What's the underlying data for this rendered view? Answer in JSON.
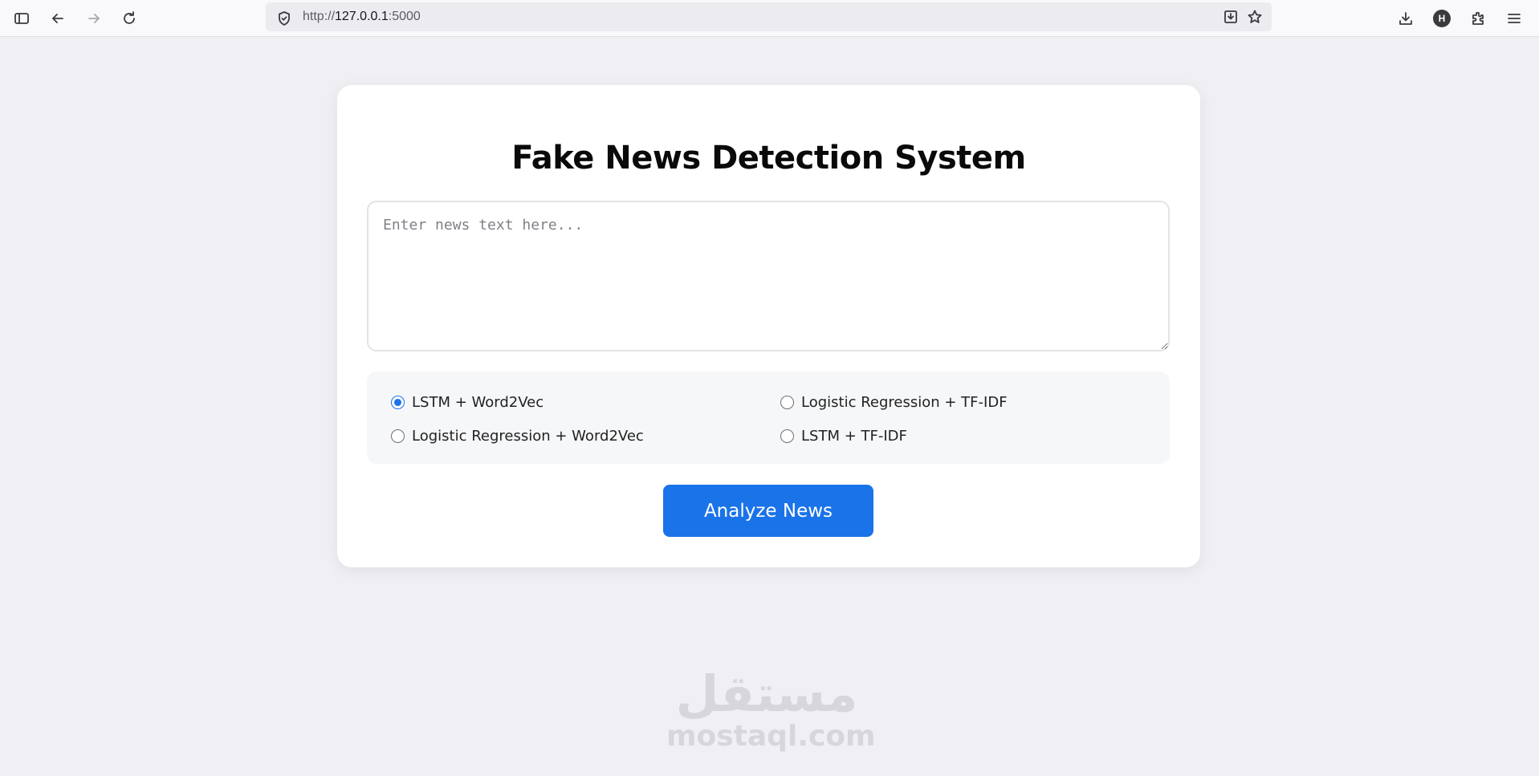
{
  "browser": {
    "url_scheme": "http://",
    "url_host": "127.0.0.1",
    "url_port": ":5000",
    "profile_initial": "H"
  },
  "page": {
    "title": "Fake News Detection System",
    "news_input_placeholder": "Enter news text here...",
    "news_input_value": "",
    "models": [
      {
        "label": "LSTM + Word2Vec",
        "checked": true
      },
      {
        "label": "Logistic Regression + TF-IDF",
        "checked": false
      },
      {
        "label": "Logistic Regression + Word2Vec",
        "checked": false
      },
      {
        "label": "LSTM + TF-IDF",
        "checked": false
      }
    ],
    "analyze_label": "Analyze News",
    "accent_color": "#1a73e8"
  },
  "watermark": {
    "arabic": "مستقل",
    "latin": "mostaql.com"
  }
}
